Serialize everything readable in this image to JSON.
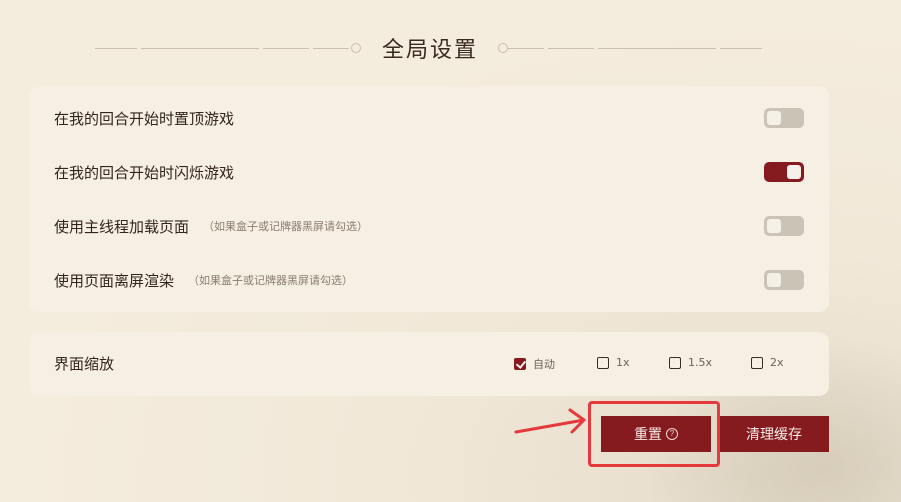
{
  "page": {
    "title": "全局设置"
  },
  "settings": {
    "rows": [
      {
        "label": "在我的回合开始时置顶游戏",
        "hint": "",
        "enabled": false
      },
      {
        "label": "在我的回合开始时闪烁游戏",
        "hint": "",
        "enabled": true
      },
      {
        "label": "使用主线程加载页面",
        "hint": "（如果盒子或记牌器黑屏请勾选）",
        "enabled": false
      },
      {
        "label": "使用页面离屏渲染",
        "hint": "（如果盒子或记牌器黑屏请勾选）",
        "enabled": false
      }
    ]
  },
  "scale": {
    "label": "界面缩放",
    "options": [
      {
        "label": "自动",
        "checked": true
      },
      {
        "label": "1x",
        "checked": false
      },
      {
        "label": "1.5x",
        "checked": false
      },
      {
        "label": "2x",
        "checked": false
      }
    ]
  },
  "buttons": {
    "reset_label": "重置",
    "help_glyph": "?",
    "clear_label": "清理缓存"
  },
  "colors": {
    "accent": "#851a1f",
    "toggle_off": "#cbc3b5",
    "panel": "#f6efe3",
    "annotation": "#e4393d"
  },
  "icons": [
    "question-circle-icon",
    "checkmark-icon",
    "arrow-right-icon"
  ]
}
